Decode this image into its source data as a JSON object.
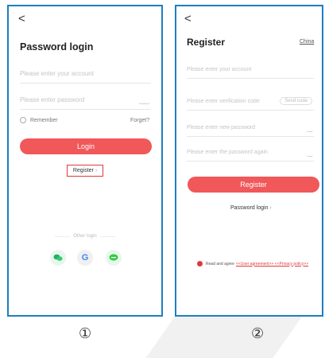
{
  "screen1": {
    "back_glyph": "<",
    "title": "Password login",
    "account_placeholder": "Please enter your account",
    "password_placeholder": "Please enter password",
    "eye_icon": "eye-closed-icon",
    "remember_label": "Remember",
    "forget_label": "Forget?",
    "login_label": "Login",
    "register_label": "Register",
    "register_arrow": "›",
    "other_login_label": "Other login",
    "social": [
      {
        "name": "wechat-icon",
        "color": "#27ae60"
      },
      {
        "name": "google-icon",
        "glyph": "G",
        "color": "#4285f4"
      },
      {
        "name": "line-icon",
        "color": "#2ecc40"
      }
    ],
    "caption": "①"
  },
  "screen2": {
    "back_glyph": "<",
    "title": "Register",
    "region_label": "China",
    "account_placeholder": "Please enter your account",
    "code_placeholder": "Please enter verification code",
    "send_code_label": "Send code",
    "new_password_placeholder": "Please enter new password",
    "again_password_placeholder": "Please enter the password again",
    "register_label": "Register",
    "password_login_label": "Password login",
    "password_login_arrow": "›",
    "agree_text": "Read and agree",
    "agreement_links": "<<User agreement>> <<Privacy policy>>",
    "caption": "②"
  },
  "colors": {
    "accent": "#f0585a",
    "frame": "#1d7fc1",
    "highlight": "#e0393c"
  }
}
